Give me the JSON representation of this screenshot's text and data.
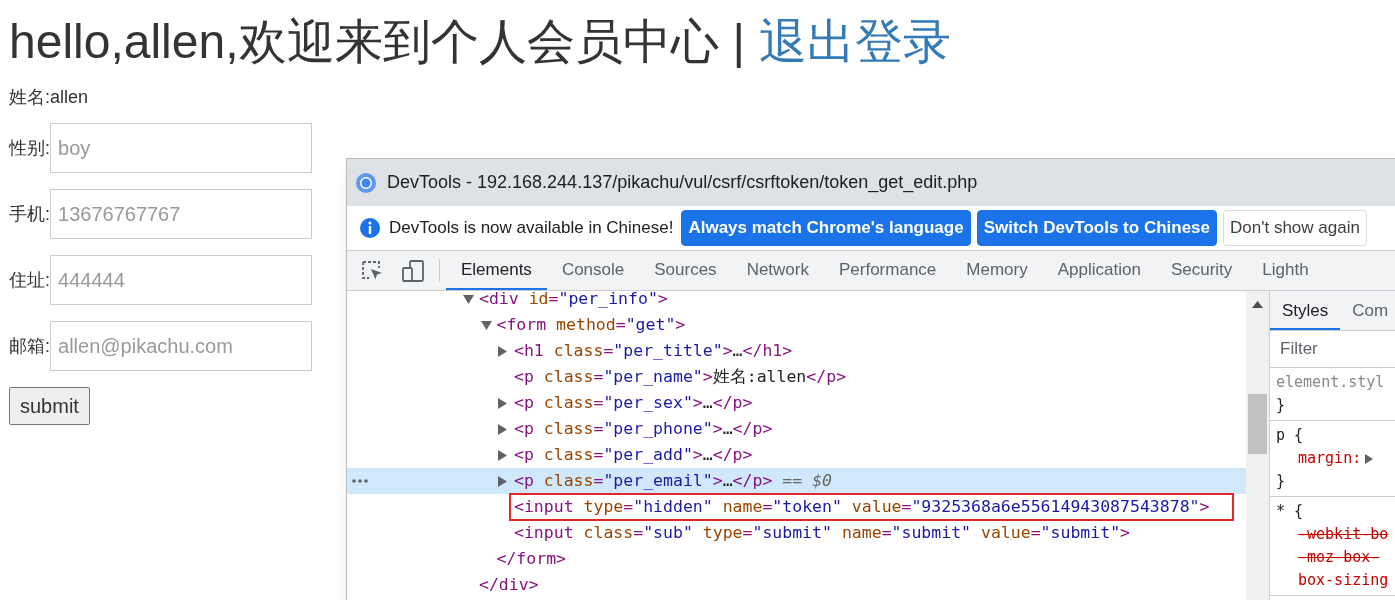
{
  "page": {
    "heading": "hello,allen,欢迎来到个人会员中心",
    "separator": "|",
    "logout_link": "退出登录",
    "name_line": "姓名:allen",
    "fields": [
      {
        "label": "性别:",
        "placeholder": "boy"
      },
      {
        "label": "手机:",
        "placeholder": "13676767767"
      },
      {
        "label": "住址:",
        "placeholder": "444444"
      },
      {
        "label": "邮箱:",
        "placeholder": "allen@pikachu.com"
      }
    ],
    "submit_button": "submit"
  },
  "devtools": {
    "title": "DevTools - 192.168.244.137/pikachu/vul/csrf/csrftoken/token_get_edit.php",
    "infobar": {
      "message": "DevTools is now available in Chinese!",
      "buttons": [
        {
          "label": "Always match Chrome's language",
          "kind": "primary"
        },
        {
          "label": "Switch DevTools to Chinese",
          "kind": "primary"
        },
        {
          "label": "Don't show again",
          "kind": "secondary"
        }
      ]
    },
    "tabs": [
      {
        "label": "Elements",
        "selected": true
      },
      {
        "label": "Console",
        "selected": false
      },
      {
        "label": "Sources",
        "selected": false
      },
      {
        "label": "Network",
        "selected": false
      },
      {
        "label": "Performance",
        "selected": false
      },
      {
        "label": "Memory",
        "selected": false
      },
      {
        "label": "Application",
        "selected": false
      },
      {
        "label": "Security",
        "selected": false
      },
      {
        "label": "Lighth",
        "selected": false
      }
    ],
    "dom_tree": [
      {
        "text": "<div id=\"per_info\">",
        "expanded": true,
        "selected": false,
        "boxed": false,
        "closing": "</div>",
        "children": [
          {
            "text": "<form method=\"get\">",
            "expanded": true,
            "selected": false,
            "boxed": false,
            "closing": "</form>",
            "children": [
              {
                "text": "<h1 class=\"per_title\">…</h1>",
                "expanded": false,
                "selected": false,
                "boxed": false
              },
              {
                "text": "<p class=\"per_name\">姓名:allen</p>",
                "selected": false,
                "boxed": false
              },
              {
                "text": "<p class=\"per_sex\">…</p>",
                "expanded": false,
                "selected": false,
                "boxed": false
              },
              {
                "text": "<p class=\"per_phone\">…</p>",
                "expanded": false,
                "selected": false,
                "boxed": false
              },
              {
                "text": "<p class=\"per_add\">…</p>",
                "expanded": false,
                "selected": false,
                "boxed": false
              },
              {
                "text": "<p class=\"per_email\">…</p>",
                "expanded": false,
                "selected": true,
                "boxed": false,
                "suffix": "== $0"
              },
              {
                "text": "<input type=\"hidden\" name=\"token\" value=\"9325368a6e55614943087543878\">",
                "selected": false,
                "boxed": true
              },
              {
                "text": "<input class=\"sub\" type=\"submit\" name=\"submit\" value=\"submit\">",
                "selected": false,
                "boxed": false
              }
            ]
          }
        ]
      }
    ],
    "side_tabs": [
      {
        "label": "Styles",
        "selected": true
      },
      {
        "label": "Com",
        "selected": false
      }
    ],
    "filter": {
      "placeholder": "Filter"
    },
    "style_rules": [
      {
        "lines": [
          {
            "text": "element.styl",
            "kind": "selector_dim"
          },
          {
            "text": "}",
            "kind": "brace"
          }
        ]
      },
      {
        "lines": [
          {
            "text": "p {",
            "kind": "selector"
          },
          {
            "text": "margin:",
            "kind": "prop_expandable"
          },
          {
            "text": "}",
            "kind": "brace"
          }
        ]
      },
      {
        "lines": [
          {
            "text": "* {",
            "kind": "selector"
          },
          {
            "text": "-webkit-bo",
            "kind": "prop_struck"
          },
          {
            "text": "-moz-box-",
            "kind": "prop_struck"
          },
          {
            "text": "box-sizing",
            "kind": "prop"
          }
        ]
      }
    ]
  }
}
